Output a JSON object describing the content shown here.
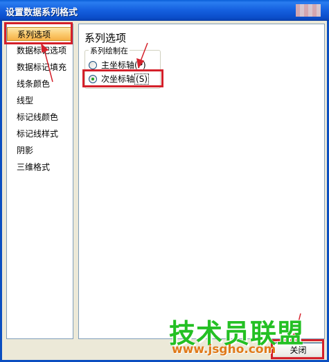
{
  "window": {
    "title": "设置数据系列格式"
  },
  "sidebar": {
    "items": [
      {
        "label": "系列选项",
        "selected": true
      },
      {
        "label": "数据标记选项",
        "selected": false
      },
      {
        "label": "数据标记填充",
        "selected": false
      },
      {
        "label": "线条颜色",
        "selected": false
      },
      {
        "label": "线型",
        "selected": false
      },
      {
        "label": "标记线颜色",
        "selected": false
      },
      {
        "label": "标记线样式",
        "selected": false
      },
      {
        "label": "阴影",
        "selected": false
      },
      {
        "label": "三维格式",
        "selected": false
      }
    ]
  },
  "main": {
    "section_title": "系列选项",
    "group_label": "系列绘制在",
    "options": [
      {
        "label": "主坐标轴",
        "accesskey": "P",
        "checked": false
      },
      {
        "label": "次坐标轴",
        "accesskey": "S",
        "checked": true
      }
    ]
  },
  "footer": {
    "close_label": "关闭"
  },
  "watermark": {
    "brand": "技术员联盟",
    "url": "www.jsgho.com"
  },
  "colors": {
    "titlebar": "#0a5fd8",
    "highlight": "#d4202a",
    "selected_item": "#fbc96c",
    "watermark_text": "#24c024",
    "watermark_url": "#e07a1a"
  },
  "icons": [
    "radio-unchecked-icon",
    "radio-checked-icon",
    "arrow-annotation-icon"
  ]
}
